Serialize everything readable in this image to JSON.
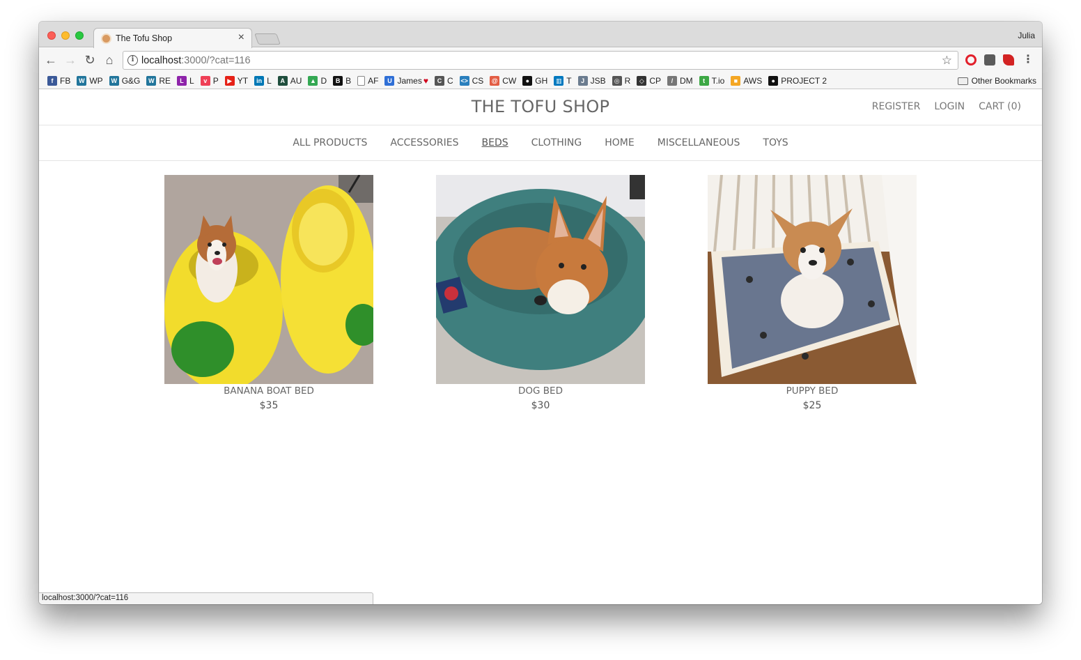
{
  "browser": {
    "tab_title": "The Tofu Shop",
    "tab_close": "×",
    "profile_name": "Julia",
    "url_host": "localhost",
    "url_rest": ":3000/?cat=116",
    "status_url": "localhost:3000/?cat=116"
  },
  "bookmarks": [
    {
      "label": "FB",
      "icon": "facebook-icon",
      "color": "#3b5998",
      "glyph": "f"
    },
    {
      "label": "WP",
      "icon": "wordpress-icon",
      "color": "#21759b",
      "glyph": "W"
    },
    {
      "label": "G&G",
      "icon": "wordpress-icon",
      "color": "#21759b",
      "glyph": "W"
    },
    {
      "label": "RE",
      "icon": "wordpress-icon",
      "color": "#21759b",
      "glyph": "W"
    },
    {
      "label": "L",
      "icon": "l-icon",
      "color": "#8e24aa",
      "glyph": "L"
    },
    {
      "label": "P",
      "icon": "pocket-icon",
      "color": "#ef3f56",
      "glyph": "v"
    },
    {
      "label": "YT",
      "icon": "youtube-icon",
      "color": "#e62117",
      "glyph": "▶"
    },
    {
      "label": "L",
      "icon": "linkedin-icon",
      "color": "#0077b5",
      "glyph": "in"
    },
    {
      "label": "AU",
      "icon": "au-icon",
      "color": "#1f4e3d",
      "glyph": "A"
    },
    {
      "label": "D",
      "icon": "drive-icon",
      "color": "#34a853",
      "glyph": "▲"
    },
    {
      "label": "B",
      "icon": "b-icon",
      "color": "#111111",
      "glyph": "B"
    },
    {
      "label": "AF",
      "icon": "page-icon",
      "color": "#ffffff",
      "glyph": ""
    },
    {
      "label": "James",
      "icon": "u-icon",
      "color": "#2f6fd6",
      "glyph": "U",
      "suffix": "♥"
    },
    {
      "label": "C",
      "icon": "c-icon",
      "color": "#555555",
      "glyph": "C"
    },
    {
      "label": "CS",
      "icon": "code-icon",
      "color": "#2a7fbd",
      "glyph": "<>"
    },
    {
      "label": "CW",
      "icon": "cw-icon",
      "color": "#e35d44",
      "glyph": "@"
    },
    {
      "label": "GH",
      "icon": "github-icon",
      "color": "#111111",
      "glyph": "●"
    },
    {
      "label": "T",
      "icon": "trello-icon",
      "color": "#0079bf",
      "glyph": "▥"
    },
    {
      "label": "JSB",
      "icon": "jsbin-icon",
      "color": "#6b7c8f",
      "glyph": "J"
    },
    {
      "label": "R",
      "icon": "r-icon",
      "color": "#555555",
      "glyph": "◎"
    },
    {
      "label": "CP",
      "icon": "codepen-icon",
      "color": "#333333",
      "glyph": "◇"
    },
    {
      "label": "DM",
      "icon": "slash-icon",
      "color": "#777777",
      "glyph": "/"
    },
    {
      "label": "T.io",
      "icon": "t-icon",
      "color": "#3da845",
      "glyph": "t"
    },
    {
      "label": "AWS",
      "icon": "aws-icon",
      "color": "#f4a623",
      "glyph": "■"
    },
    {
      "label": "PROJECT 2",
      "icon": "github-icon",
      "color": "#111111",
      "glyph": "●"
    }
  ],
  "other_bookmarks": "Other Bookmarks",
  "site": {
    "title": "THE TOFU SHOP",
    "register": "REGISTER",
    "login": "LOGIN",
    "cart": "CART (0)"
  },
  "categories": [
    "ALL PRODUCTS",
    "ACCESSORIES",
    "BEDS",
    "CLOTHING",
    "HOME",
    "MISCELLANEOUS",
    "TOYS"
  ],
  "active_category": "BEDS",
  "products": [
    {
      "name": "BANANA BOAT BED",
      "price": "$35"
    },
    {
      "name": "DOG BED",
      "price": "$30"
    },
    {
      "name": "PUPPY BED",
      "price": "$25"
    }
  ],
  "colors": {
    "text_muted": "#666666",
    "chrome_bg": "#dcdcdc",
    "toolbar_bg": "#f6f6f6"
  }
}
